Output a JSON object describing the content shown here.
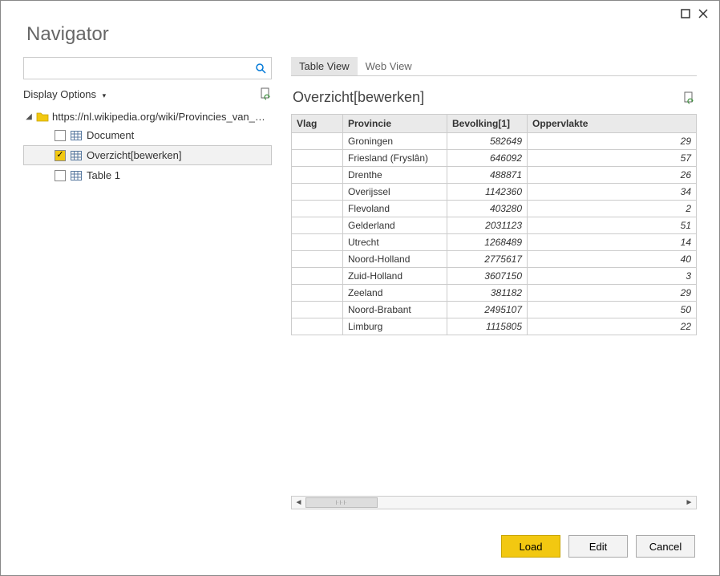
{
  "title": "Navigator",
  "tabs": {
    "table": "Table View",
    "web": "Web View"
  },
  "display_options": "Display Options",
  "tree": {
    "root": "https://nl.wikipedia.org/wiki/Provincies_van_N...",
    "items": [
      {
        "label": "Document",
        "checked": false
      },
      {
        "label": "Overzicht[bewerken]",
        "checked": true
      },
      {
        "label": "Table 1",
        "checked": false
      }
    ]
  },
  "preview": {
    "title": "Overzicht[bewerken]",
    "columns": [
      "Vlag",
      "Provincie",
      "Bevolking[1]",
      "Oppervlakte"
    ],
    "rows": [
      {
        "vlag": "",
        "provincie": "Groningen",
        "bevolking": "582649",
        "oppervlakte": "29"
      },
      {
        "vlag": "",
        "provincie": "Friesland (Fryslân)",
        "bevolking": "646092",
        "oppervlakte": "57"
      },
      {
        "vlag": "",
        "provincie": "Drenthe",
        "bevolking": "488871",
        "oppervlakte": "26"
      },
      {
        "vlag": "",
        "provincie": "Overijssel",
        "bevolking": "1142360",
        "oppervlakte": "34"
      },
      {
        "vlag": "",
        "provincie": "Flevoland",
        "bevolking": "403280",
        "oppervlakte": "2"
      },
      {
        "vlag": "",
        "provincie": "Gelderland",
        "bevolking": "2031123",
        "oppervlakte": "51"
      },
      {
        "vlag": "",
        "provincie": "Utrecht",
        "bevolking": "1268489",
        "oppervlakte": "14"
      },
      {
        "vlag": "",
        "provincie": "Noord-Holland",
        "bevolking": "2775617",
        "oppervlakte": "40"
      },
      {
        "vlag": "",
        "provincie": "Zuid-Holland",
        "bevolking": "3607150",
        "oppervlakte": "3"
      },
      {
        "vlag": "",
        "provincie": "Zeeland",
        "bevolking": "381182",
        "oppervlakte": "29"
      },
      {
        "vlag": "",
        "provincie": "Noord-Brabant",
        "bevolking": "2495107",
        "oppervlakte": "50"
      },
      {
        "vlag": "",
        "provincie": "Limburg",
        "bevolking": "1115805",
        "oppervlakte": "22"
      }
    ]
  },
  "buttons": {
    "load": "Load",
    "edit": "Edit",
    "cancel": "Cancel"
  }
}
